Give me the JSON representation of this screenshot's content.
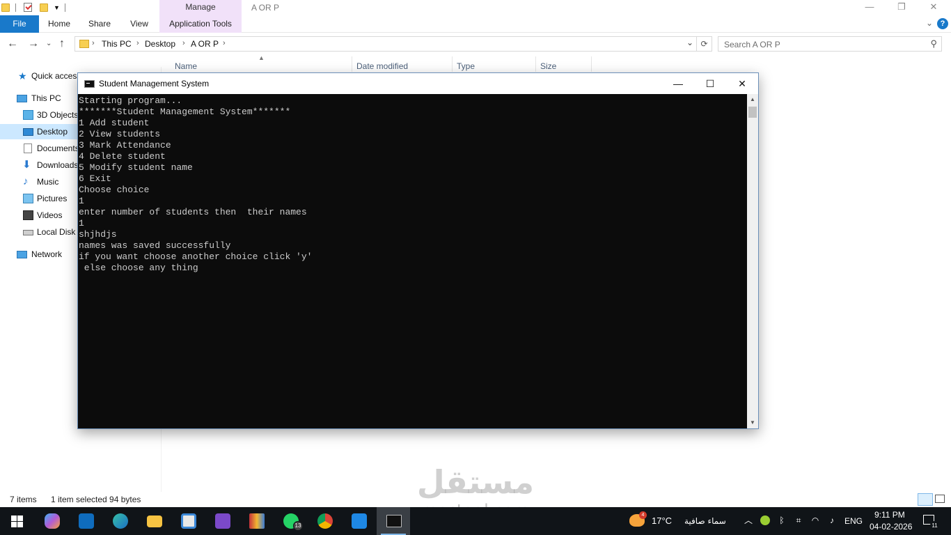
{
  "explorer": {
    "ribbon_context_header": "Manage",
    "window_title": "A OR P",
    "tabs": {
      "file": "File",
      "home": "Home",
      "share": "Share",
      "view": "View",
      "app_tools": "Application Tools"
    },
    "window_controls": {
      "minimize": "—",
      "restore": "❐",
      "close": "✕"
    },
    "address": {
      "crumbs": [
        "This PC",
        "Desktop",
        "A OR P"
      ],
      "separator": "›"
    },
    "search": {
      "placeholder": "Search A OR P"
    },
    "columns": [
      "Name",
      "Date modified",
      "Type",
      "Size"
    ],
    "nav": {
      "quick_access": "Quick access",
      "this_pc": "This PC",
      "objects3d": "3D Objects",
      "desktop": "Desktop",
      "documents": "Documents",
      "downloads": "Downloads",
      "music": "Music",
      "pictures": "Pictures",
      "videos": "Videos",
      "local_disk": "Local Disk",
      "network": "Network"
    },
    "status": {
      "item_count": "7 items",
      "selection": "1 item selected  94 bytes"
    }
  },
  "console": {
    "title": "Student Management System",
    "lines": [
      "Starting program...",
      "*******Student Management System*******",
      "1 Add student",
      "2 View students",
      "3 Mark Attendance",
      "4 Delete student",
      "5 Modify student name",
      "6 Exit",
      "Choose choice",
      "1",
      "enter number of students then  their names",
      "1",
      "shjhdjs",
      "names was saved successfully",
      "if you want choose another choice click 'y'",
      " else choose any thing"
    ]
  },
  "watermark": {
    "arabic": "مستقل",
    "latin": "mostaql.com"
  },
  "taskbar": {
    "apps": [
      "start",
      "copilot",
      "outlook",
      "edge",
      "file-explorer",
      "store",
      "visual-studio",
      "winrar",
      "whatsapp",
      "chrome",
      "vscode",
      "terminal"
    ],
    "whatsapp_badge": "13",
    "weather": {
      "temp": "17°C",
      "description": "سماء صافية",
      "badge": "4"
    },
    "language": "ENG",
    "time": "9:11 PM",
    "date": "04-02-2026",
    "notification_count": "11"
  },
  "colors": {
    "file_tab": "#1979ca",
    "context_tab": "#f1e1f9",
    "selected_nav": "#cce8ff",
    "console_bg": "#0c0c0c",
    "console_text": "#cccccc",
    "taskbar": "#101418"
  }
}
